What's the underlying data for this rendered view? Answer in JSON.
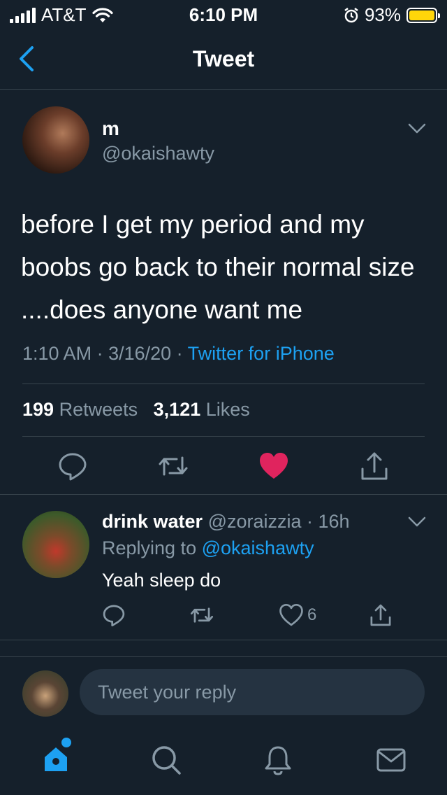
{
  "status_bar": {
    "carrier": "AT&T",
    "time": "6:10 PM",
    "battery": "93%",
    "battery_level": 0.93,
    "battery_color": "#ffd60a"
  },
  "nav": {
    "title": "Tweet",
    "back_icon": "chevron-left-icon"
  },
  "tweet": {
    "name": "m",
    "handle": "@okaishawty",
    "text": "before I get my period and my boobs go back to their normal size ....does anyone want me",
    "time": "1:10 AM",
    "date": "3/16/20",
    "source": "Twitter for iPhone",
    "retweets_count": "199",
    "retweets_label": "Retweets",
    "likes_count": "3,121",
    "likes_label": "Likes",
    "liked": true
  },
  "reply": {
    "name": "drink water",
    "handle": "@zoraizzia",
    "age": "16h",
    "replying_label": "Replying to",
    "replying_to": "@okaishawty",
    "text": "Yeah sleep do",
    "like_count": "6"
  },
  "compose": {
    "placeholder": "Tweet your reply"
  },
  "tab_bar": {
    "items": [
      "home-icon",
      "search-icon",
      "notifications-icon",
      "messages-icon"
    ],
    "active": "home-icon",
    "accent": "#1da1f2"
  },
  "colors": {
    "background": "#15202b",
    "secondary_text": "#8899a6",
    "link": "#1da1f2",
    "like": "#e0245e",
    "divider": "#38444d"
  }
}
